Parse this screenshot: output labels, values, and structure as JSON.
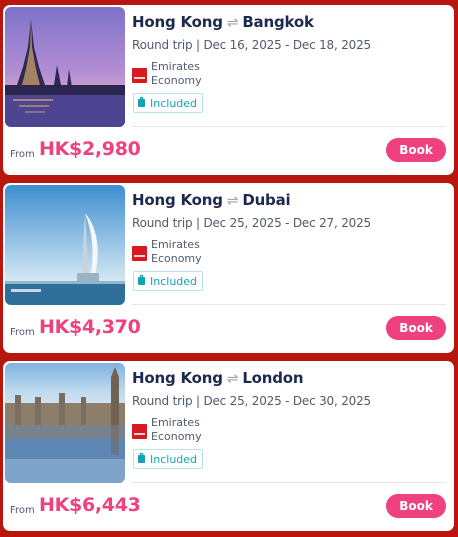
{
  "colors": {
    "page_background": "#b8170f",
    "price": "#f0417f",
    "book_button": "#f0417f",
    "baggage_accent": "#13a3b7",
    "title": "#1b2a4e"
  },
  "route_separator_icon": "swap-arrows-icon",
  "deals": [
    {
      "origin": "Hong Kong",
      "destination": "Bangkok",
      "trip": "Round trip | Dec 16, 2025 - Dec 18, 2025",
      "airline": "Emirates",
      "cabin": "Economy",
      "baggage": "Included",
      "from_label": "From",
      "price": "HK$2,980",
      "book_label": "Book",
      "image_icon": "bangkok-temple-photo"
    },
    {
      "origin": "Hong Kong",
      "destination": "Dubai",
      "trip": "Round trip | Dec 25, 2025 - Dec 27, 2025",
      "airline": "Emirates",
      "cabin": "Economy",
      "baggage": "Included",
      "from_label": "From",
      "price": "HK$4,370",
      "book_label": "Book",
      "image_icon": "dubai-burj-al-arab-photo"
    },
    {
      "origin": "Hong Kong",
      "destination": "London",
      "trip": "Round trip | Dec 25, 2025 - Dec 30, 2025",
      "airline": "Emirates",
      "cabin": "Economy",
      "baggage": "Included",
      "from_label": "From",
      "price": "HK$6,443",
      "book_label": "Book",
      "image_icon": "london-parliament-photo"
    }
  ]
}
